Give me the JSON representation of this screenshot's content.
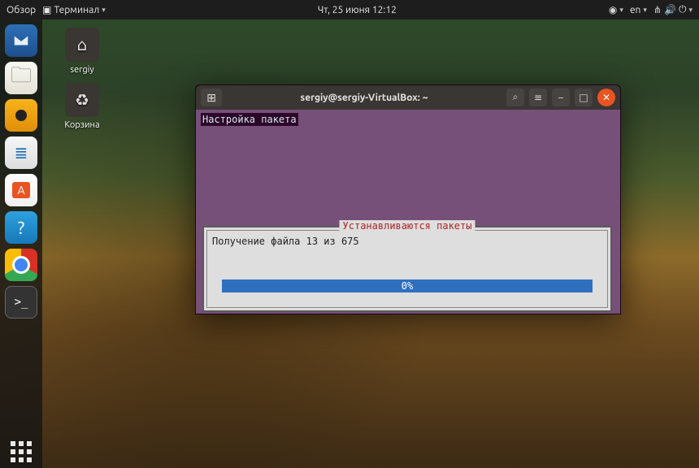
{
  "topbar": {
    "activities": "Обзор",
    "app_menu": "Терминал",
    "clock": "Чт, 25 июня  12:12",
    "lang": "en"
  },
  "desktop": {
    "home_label": "sergiy",
    "trash_label": "Корзина"
  },
  "dock": {
    "items": [
      "thunderbird",
      "files",
      "rhythmbox",
      "writer",
      "software",
      "help",
      "chrome",
      "terminal"
    ]
  },
  "terminal": {
    "title": "sergiy@sergiy-VirtualBox: ~",
    "config_header": "Настройка пакета",
    "box_title": "Устанавливаются пакеты",
    "status_line": "Получение файла 13 из 675",
    "progress_pct": "0%"
  },
  "colors": {
    "term_purple": "#77507a",
    "accent_orange": "#e95420",
    "progress_blue": "#2e6fc0"
  }
}
